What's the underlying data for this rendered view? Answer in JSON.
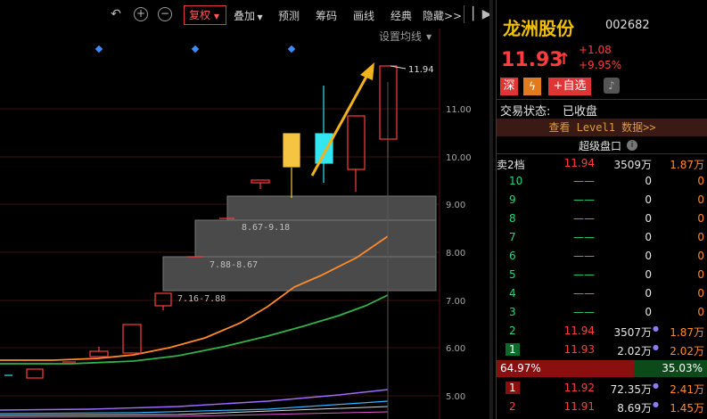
{
  "toolbar": {
    "fuquan_label": "复权",
    "items": [
      "叠加",
      "预测",
      "筹码",
      "画线",
      "经典",
      "隐藏>>"
    ]
  },
  "chart": {
    "settings_label": "设置均线",
    "high_label": "11.94",
    "zone_labels": [
      "8.67-9.18",
      "7.88-8.67",
      "7.16-7.88"
    ],
    "price_ticks": [
      "11.00",
      "10.00",
      "9.00",
      "8.00",
      "7.00",
      "6.00",
      "5.00"
    ]
  },
  "stock": {
    "name": "龙洲股份",
    "code": "002682",
    "price": "11.93",
    "arrow": "↑",
    "change": "+1.08",
    "change_pct": "+9.95%",
    "tag_shen": "深",
    "tag_add": "+自选",
    "status_label": "交易状态:",
    "status_value": "已收盘",
    "level1_link": "查看 Level1 数据>>",
    "super_panel": "超级盘口",
    "sell_header": "卖2档",
    "sell_header_price": "11.94",
    "sell_header_vol": "3509万",
    "sell_header_amt": "1.87万"
  },
  "sell_rows": [
    {
      "lvl": "10",
      "price": "——",
      "vol": "0",
      "amt": "0"
    },
    {
      "lvl": "9",
      "price": "——",
      "vol": "0",
      "amt": "0"
    },
    {
      "lvl": "8",
      "price": "——",
      "vol": "0",
      "amt": "0"
    },
    {
      "lvl": "7",
      "price": "——",
      "vol": "0",
      "amt": "0"
    },
    {
      "lvl": "6",
      "price": "——",
      "vol": "0",
      "amt": "0"
    },
    {
      "lvl": "5",
      "price": "——",
      "vol": "0",
      "amt": "0"
    },
    {
      "lvl": "4",
      "price": "——",
      "vol": "0",
      "amt": "0"
    },
    {
      "lvl": "3",
      "price": "——",
      "vol": "0",
      "amt": "0"
    },
    {
      "lvl": "2",
      "price": "11.94",
      "vol": "3507万",
      "amt": "1.87万"
    },
    {
      "lvl": "1",
      "price": "11.93",
      "vol": "2.02万",
      "amt": "2.02万"
    }
  ],
  "ratio": {
    "left": "64.97%",
    "right": "35.03%",
    "left_fraction": 0.6497
  },
  "buy_rows": [
    {
      "lvl": "1",
      "price": "11.92",
      "vol": "72.35万",
      "amt": "2.41万"
    },
    {
      "lvl": "2",
      "price": "11.91",
      "vol": "8.69万",
      "amt": "1.45万"
    }
  ],
  "colors": {
    "red": "#ff3d3d",
    "green": "#2fd27a",
    "orange": "#ff8a2a",
    "yellow": "#f5c542",
    "cyan": "#33e6f0"
  }
}
